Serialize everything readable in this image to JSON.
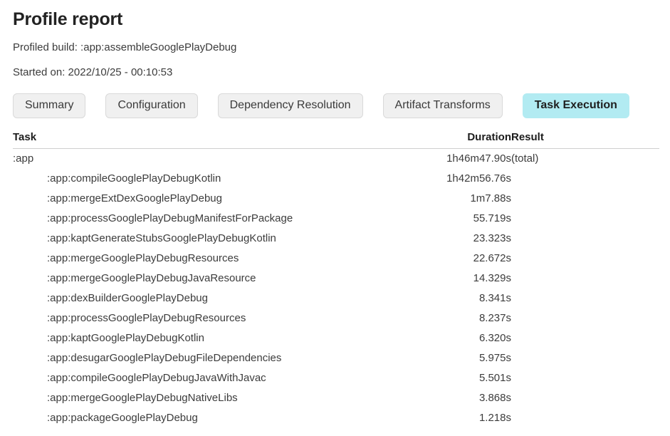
{
  "header": {
    "title": "Profile report",
    "profiled_build_label": "Profiled build:  :app:assembleGooglePlayDebug",
    "started_on_label": "Started on: 2022/10/25 - 00:10:53"
  },
  "tabs": [
    {
      "label": "Summary",
      "active": false
    },
    {
      "label": "Configuration",
      "active": false
    },
    {
      "label": "Dependency Resolution",
      "active": false
    },
    {
      "label": "Artifact Transforms",
      "active": false
    },
    {
      "label": "Task Execution",
      "active": true
    }
  ],
  "table": {
    "columns": [
      "Task",
      "Duration",
      "Result"
    ],
    "rows": [
      {
        "task": ":app",
        "duration": "1h46m47.90s",
        "result": "(total)",
        "indented": false
      },
      {
        "task": ":app:compileGooglePlayDebugKotlin",
        "duration": "1h42m56.76s",
        "result": "",
        "indented": true
      },
      {
        "task": ":app:mergeExtDexGooglePlayDebug",
        "duration": "1m7.88s",
        "result": "",
        "indented": true
      },
      {
        "task": ":app:processGooglePlayDebugManifestForPackage",
        "duration": "55.719s",
        "result": "",
        "indented": true
      },
      {
        "task": ":app:kaptGenerateStubsGooglePlayDebugKotlin",
        "duration": "23.323s",
        "result": "",
        "indented": true
      },
      {
        "task": ":app:mergeGooglePlayDebugResources",
        "duration": "22.672s",
        "result": "",
        "indented": true
      },
      {
        "task": ":app:mergeGooglePlayDebugJavaResource",
        "duration": "14.329s",
        "result": "",
        "indented": true
      },
      {
        "task": ":app:dexBuilderGooglePlayDebug",
        "duration": "8.341s",
        "result": "",
        "indented": true
      },
      {
        "task": ":app:processGooglePlayDebugResources",
        "duration": "8.237s",
        "result": "",
        "indented": true
      },
      {
        "task": ":app:kaptGooglePlayDebugKotlin",
        "duration": "6.320s",
        "result": "",
        "indented": true
      },
      {
        "task": ":app:desugarGooglePlayDebugFileDependencies",
        "duration": "5.975s",
        "result": "",
        "indented": true
      },
      {
        "task": ":app:compileGooglePlayDebugJavaWithJavac",
        "duration": "5.501s",
        "result": "",
        "indented": true
      },
      {
        "task": ":app:mergeGooglePlayDebugNativeLibs",
        "duration": "3.868s",
        "result": "",
        "indented": true
      },
      {
        "task": ":app:packageGooglePlayDebug",
        "duration": "1.218s",
        "result": "",
        "indented": true
      }
    ]
  },
  "colors": {
    "active_tab_background": "#b2ebf2",
    "inactive_tab_background": "#f0f0f0",
    "text": "#3c3c3c",
    "heading": "#222222",
    "divider": "#cfcfcf"
  }
}
